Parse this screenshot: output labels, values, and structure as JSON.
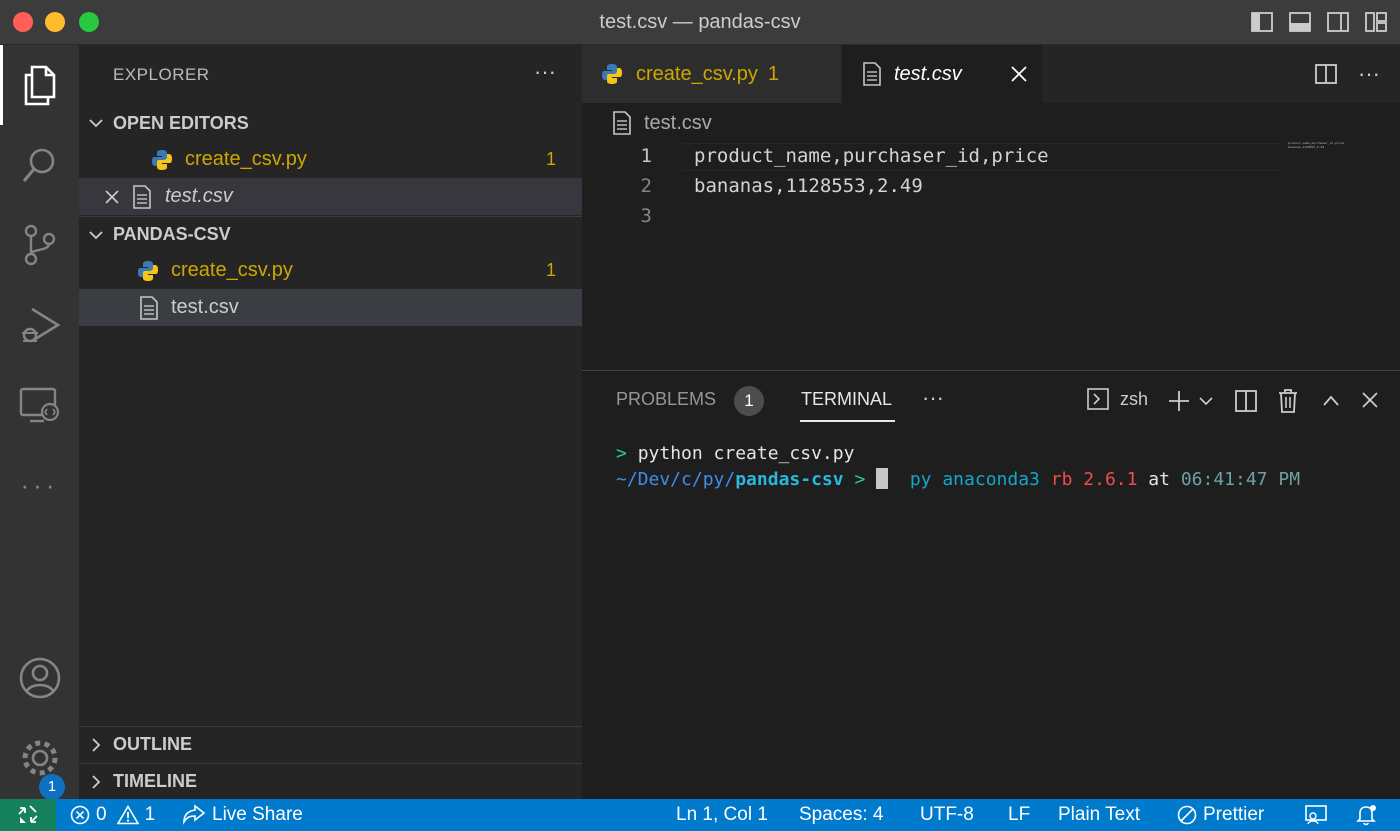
{
  "window": {
    "title": "test.csv — pandas-csv"
  },
  "activity_bar": {
    "items": [
      "explorer-icon",
      "search-icon",
      "source-control-icon",
      "run-debug-icon",
      "remote-explorer-icon",
      "more-icon"
    ],
    "accounts_icon": "account-icon",
    "settings_icon": "gear-icon",
    "settings_badge": "1"
  },
  "sidebar": {
    "title": "EXPLORER",
    "more": "···",
    "open_editors": {
      "label": "OPEN EDITORS",
      "items": [
        {
          "name": "create_csv.py",
          "count": "1"
        },
        {
          "name": "test.csv"
        }
      ]
    },
    "folder": {
      "label": "PANDAS-CSV",
      "items": [
        {
          "name": "create_csv.py",
          "count": "1"
        },
        {
          "name": "test.csv"
        }
      ]
    },
    "outline_label": "OUTLINE",
    "timeline_label": "TIMELINE"
  },
  "editor": {
    "tabs": [
      {
        "label": "create_csv.py",
        "count": "1"
      },
      {
        "label": "test.csv"
      }
    ],
    "more": "···",
    "breadcrumb": "test.csv",
    "lines": [
      {
        "num": "1",
        "text": "product_name,purchaser_id,price"
      },
      {
        "num": "2",
        "text": "bananas,1128553,2.49"
      },
      {
        "num": "3",
        "text": ""
      }
    ],
    "minimap": "product_name,purchaser_id,price\nbananas,1128553,2.49"
  },
  "panel": {
    "problems_label": "PROBLEMS",
    "problems_count": "1",
    "terminal_label": "TERMINAL",
    "more": "···",
    "shell": "zsh",
    "terminal": {
      "prompt1": ">",
      "command": "python create_csv.py",
      "path_prefix": "~/Dev/c/py/",
      "path_dir": "pandas-csv",
      "prompt2": ">",
      "env_py": "py",
      "env_name": "anaconda3",
      "rb_label": "rb",
      "rb_version": "2.6.1",
      "at": "at",
      "time": "06:41:47 PM"
    }
  },
  "status_bar": {
    "errors": "0",
    "warnings": "1",
    "live_share": "Live Share",
    "position": "Ln 1, Col 1",
    "spaces": "Spaces: 4",
    "encoding": "UTF-8",
    "eol": "LF",
    "language": "Plain Text",
    "prettier": "Prettier"
  }
}
